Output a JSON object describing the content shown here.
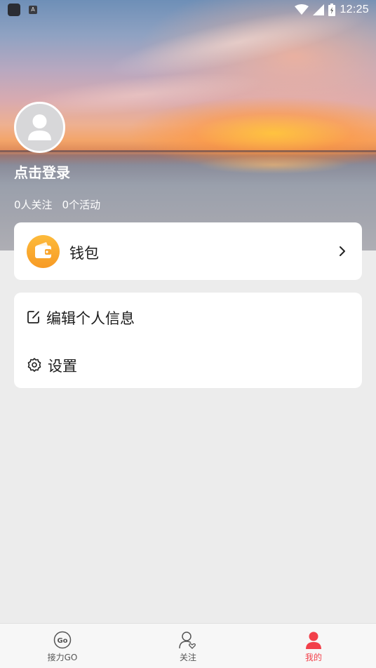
{
  "status_bar": {
    "time": "12:25",
    "notification_badge": "A"
  },
  "profile": {
    "login_prompt": "点击登录",
    "follow_count": "0人关注",
    "activity_count": "0个活动"
  },
  "wallet": {
    "label": "钱包",
    "accent_color": "#f9a52c"
  },
  "menu": {
    "items": [
      {
        "label": "编辑个人信息",
        "icon": "edit-icon"
      },
      {
        "label": "设置",
        "icon": "gear-icon"
      }
    ]
  },
  "tabbar": {
    "tabs": [
      {
        "label": "接力GO",
        "icon": "go-icon",
        "active": false
      },
      {
        "label": "关注",
        "icon": "follow-icon",
        "active": false
      },
      {
        "label": "我的",
        "icon": "person-icon",
        "active": true
      }
    ],
    "active_color": "#f2404a"
  }
}
